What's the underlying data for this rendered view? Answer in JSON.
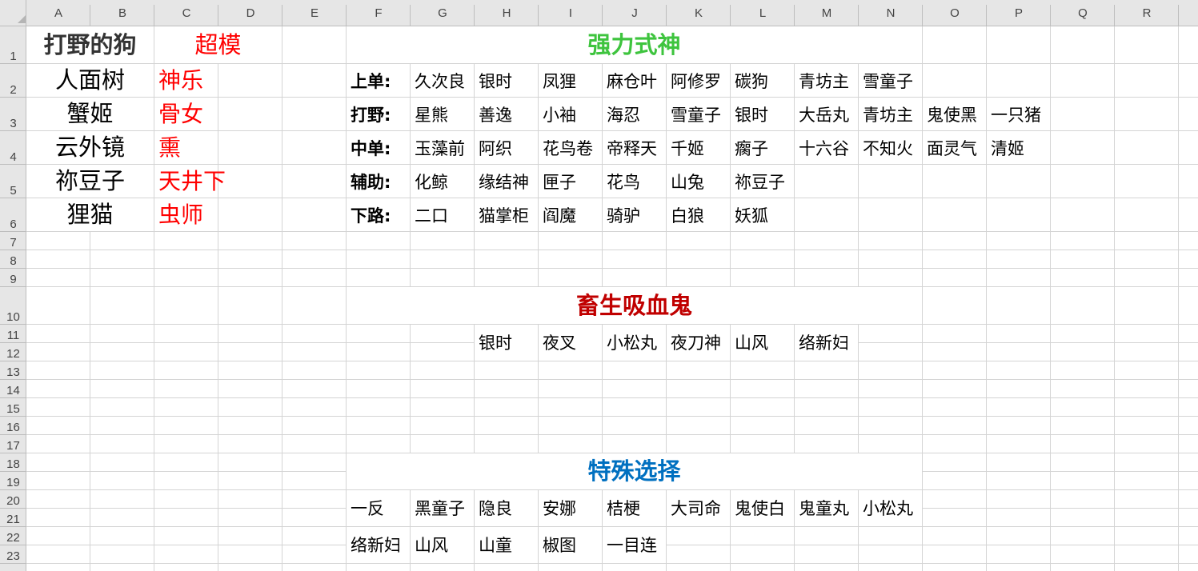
{
  "colors": {
    "grid": "#d4d4d4",
    "header_bg": "#e6e6e6",
    "red": "#ff0000",
    "green": "#3ec43e",
    "dark_red": "#c00000",
    "blue": "#0070c0",
    "dark_text": "#333333"
  },
  "columns": [
    "A",
    "B",
    "C",
    "D",
    "E",
    "F",
    "G",
    "H",
    "I",
    "J",
    "K",
    "L",
    "M",
    "N",
    "O",
    "P",
    "Q",
    "R"
  ],
  "rows": [
    "1",
    "2",
    "3",
    "4",
    "5",
    "6",
    "7",
    "8",
    "9",
    "10",
    "11",
    "12",
    "13",
    "14",
    "15",
    "16",
    "17",
    "18",
    "19",
    "20",
    "21",
    "22",
    "23"
  ],
  "left_block": {
    "header_left": "打野的狗",
    "header_right": "超模",
    "dogs": [
      "人面树",
      "蟹姬",
      "云外镜",
      "祢豆子",
      "狸猫"
    ],
    "op": [
      "神乐",
      "骨女",
      "熏",
      "天井下",
      "虫师"
    ]
  },
  "strong": {
    "title": "强力式神",
    "rows": [
      {
        "label": "上单:",
        "items": [
          "久次良",
          "银时",
          "凤狸",
          "麻仓叶",
          "阿修罗",
          "碳狗",
          "青坊主",
          "雪童子"
        ]
      },
      {
        "label": "打野:",
        "items": [
          "星熊",
          "善逸",
          "小袖",
          "海忍",
          "雪童子",
          "银时",
          "大岳丸",
          "青坊主",
          "鬼使黑",
          "一只猪"
        ]
      },
      {
        "label": "中单:",
        "items": [
          "玉藻前",
          "阿织",
          "花鸟卷",
          "帝释天",
          "千姬",
          "瘸子",
          "十六谷",
          "不知火",
          "面灵气",
          "清姬"
        ]
      },
      {
        "label": "辅助:",
        "items": [
          "化鲸",
          "缘结神",
          "匣子",
          "花鸟",
          "山兔",
          "祢豆子"
        ]
      },
      {
        "label": "下路:",
        "items": [
          "二口",
          "猫掌柜",
          "阎魔",
          "骑驴",
          "白狼",
          "妖狐"
        ]
      }
    ]
  },
  "beast": {
    "title": "畜生吸血鬼",
    "items": [
      "银时",
      "夜叉",
      "小松丸",
      "夜刀神",
      "山风",
      "络新妇"
    ]
  },
  "special": {
    "title": "特殊选择",
    "row1": [
      "一反",
      "黑童子",
      "隐良",
      "安娜",
      "桔梗",
      "大司命",
      "鬼使白",
      "鬼童丸",
      "小松丸"
    ],
    "row2": [
      "络新妇",
      "山风",
      "山童",
      "椒图",
      "一目连"
    ]
  }
}
